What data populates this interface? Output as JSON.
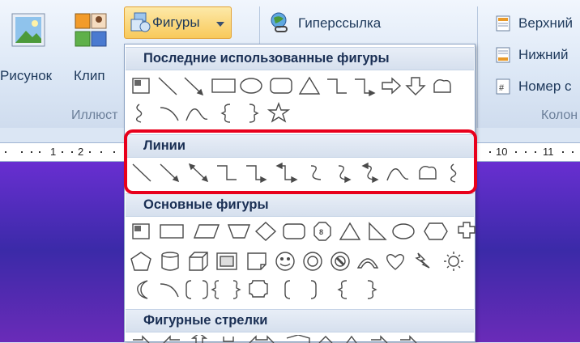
{
  "ribbon": {
    "picture_label": "Рисунок",
    "clip_label": "Клип",
    "shapes_label": "Фигуры",
    "hyperlink_label": "Гиперссылка",
    "illustrations_group": "Иллюст",
    "header_label": "Верхний",
    "footer_label": "Нижний",
    "page_number_label": "Номер с",
    "header_footer_group": "Колон"
  },
  "ruler": {
    "left_nums": [
      "1",
      "2"
    ],
    "right_nums": [
      "10",
      "11"
    ]
  },
  "dropdown": {
    "recent_header": "Последние использованные фигуры",
    "lines_header": "Линии",
    "basic_header": "Основные фигуры",
    "arrows_header": "Фигурные стрелки"
  },
  "colors": {
    "highlight": "#e8001c",
    "accent": "#f8c95b",
    "text": "#1e395b"
  },
  "icons": [
    "picture-icon",
    "clip-icon",
    "shapes-icon",
    "hyperlink-icon",
    "header-icon",
    "footer-icon",
    "page-number-icon"
  ]
}
